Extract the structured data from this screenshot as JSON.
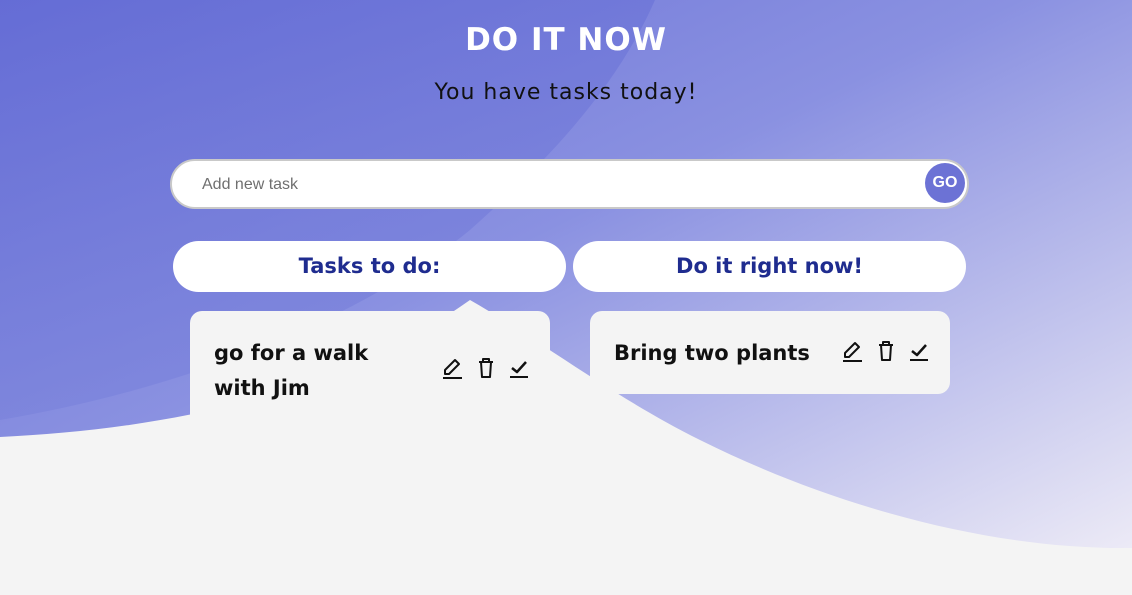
{
  "header": {
    "title": "DO IT NOW",
    "subtitle": "You have tasks today!"
  },
  "form": {
    "placeholder": "Add new task",
    "input_value": "",
    "go_label": "GO"
  },
  "columns": [
    {
      "title": "Tasks to do:",
      "tasks": [
        {
          "text": "go for a walk with Jim",
          "actions": [
            "edit-icon",
            "trash-icon",
            "checkmark-icon"
          ]
        }
      ]
    },
    {
      "title": "Do it right now!",
      "tasks": [
        {
          "text": "Bring two plants",
          "actions": [
            "edit-icon",
            "trash-icon",
            "checkmark-icon"
          ]
        }
      ]
    }
  ],
  "colors": {
    "primary": "#6c72d5",
    "header_text": "#1f2c8f",
    "background_light": "#f4f4f4"
  }
}
